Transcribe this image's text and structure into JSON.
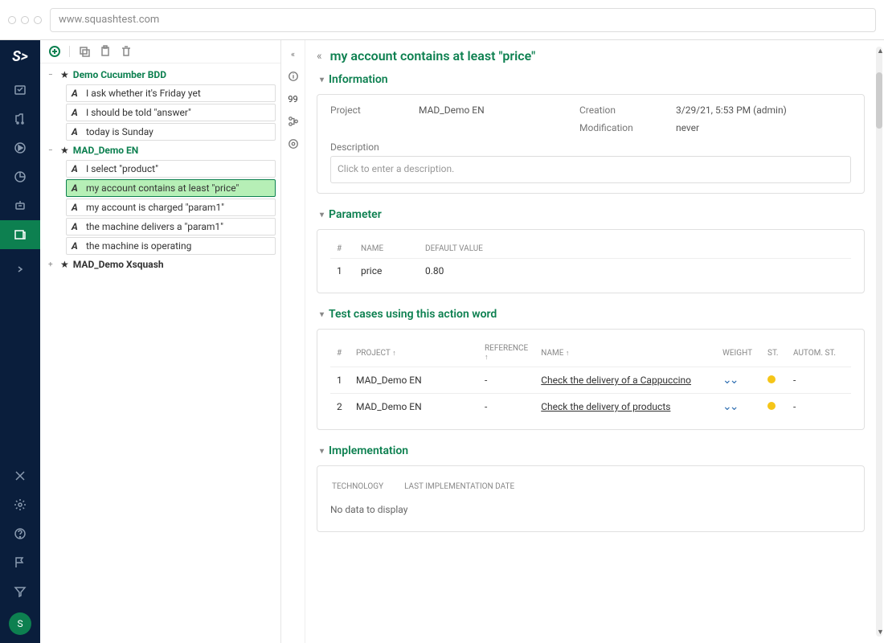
{
  "browser": {
    "url": "www.squashtest.com"
  },
  "logo_text": "S>",
  "user_initial": "S",
  "tree": {
    "projects": [
      {
        "name": "Demo Cucumber BDD",
        "expanded": true,
        "items": [
          "I ask whether it's Friday yet",
          "I should be told \"answer\"",
          "today is Sunday"
        ]
      },
      {
        "name": "MAD_Demo EN",
        "expanded": true,
        "items": [
          "I select \"product\"",
          "my account contains at least \"price\"",
          "my account is charged \"param1\"",
          "the machine delivers a \"param1\"",
          "the machine is operating"
        ],
        "selected_index": 1
      },
      {
        "name": "MAD_Demo Xsquash",
        "expanded": false
      }
    ]
  },
  "page": {
    "title": "my account contains at least \"price\"",
    "info": {
      "section_title": "Information",
      "project_label": "Project",
      "project_value": "MAD_Demo EN",
      "creation_label": "Creation",
      "creation_value": "3/29/21, 5:53 PM (admin)",
      "modification_label": "Modification",
      "modification_value": "never",
      "description_label": "Description",
      "description_placeholder": "Click to enter a description."
    },
    "parameter": {
      "section_title": "Parameter",
      "cols": {
        "num": "#",
        "name": "NAME",
        "default": "DEFAULT VALUE"
      },
      "rows": [
        {
          "num": "1",
          "name": "price",
          "default": "0.80"
        }
      ]
    },
    "testcases": {
      "section_title": "Test cases using this action word",
      "cols": {
        "num": "#",
        "project": "PROJECT",
        "reference": "REFERENCE",
        "name": "NAME",
        "weight": "WEIGHT",
        "st": "ST.",
        "autom": "AUTOM. ST."
      },
      "rows": [
        {
          "num": "1",
          "project": "MAD_Demo EN",
          "reference": "-",
          "name": "Check the delivery of a Cappuccino",
          "autom": "-"
        },
        {
          "num": "2",
          "project": "MAD_Demo EN",
          "reference": "-",
          "name": "Check the delivery of products",
          "autom": "-"
        }
      ]
    },
    "implementation": {
      "section_title": "Implementation",
      "cols": {
        "tech": "TECHNOLOGY",
        "last": "LAST IMPLEMENTATION DATE"
      },
      "nodata": "No data to display"
    },
    "tab99": "99"
  }
}
